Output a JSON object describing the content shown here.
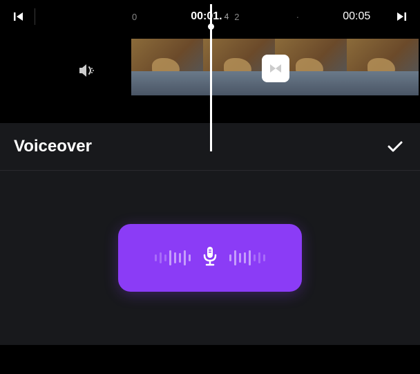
{
  "timeline": {
    "marker_start": "0",
    "current_time": "00:01.",
    "current_time_decimal": "4",
    "marker_2": "2",
    "dot": "·",
    "end_time": "00:05"
  },
  "panel": {
    "title": "Voiceover"
  },
  "icons": {
    "prev_frame": "prev-frame-icon",
    "next_frame": "next-frame-icon",
    "volume": "volume-icon",
    "transition": "transition-icon",
    "checkmark": "checkmark-icon",
    "microphone": "microphone-icon"
  },
  "colors": {
    "record_button": "#8b3cf6",
    "background_panel": "#18191c"
  }
}
